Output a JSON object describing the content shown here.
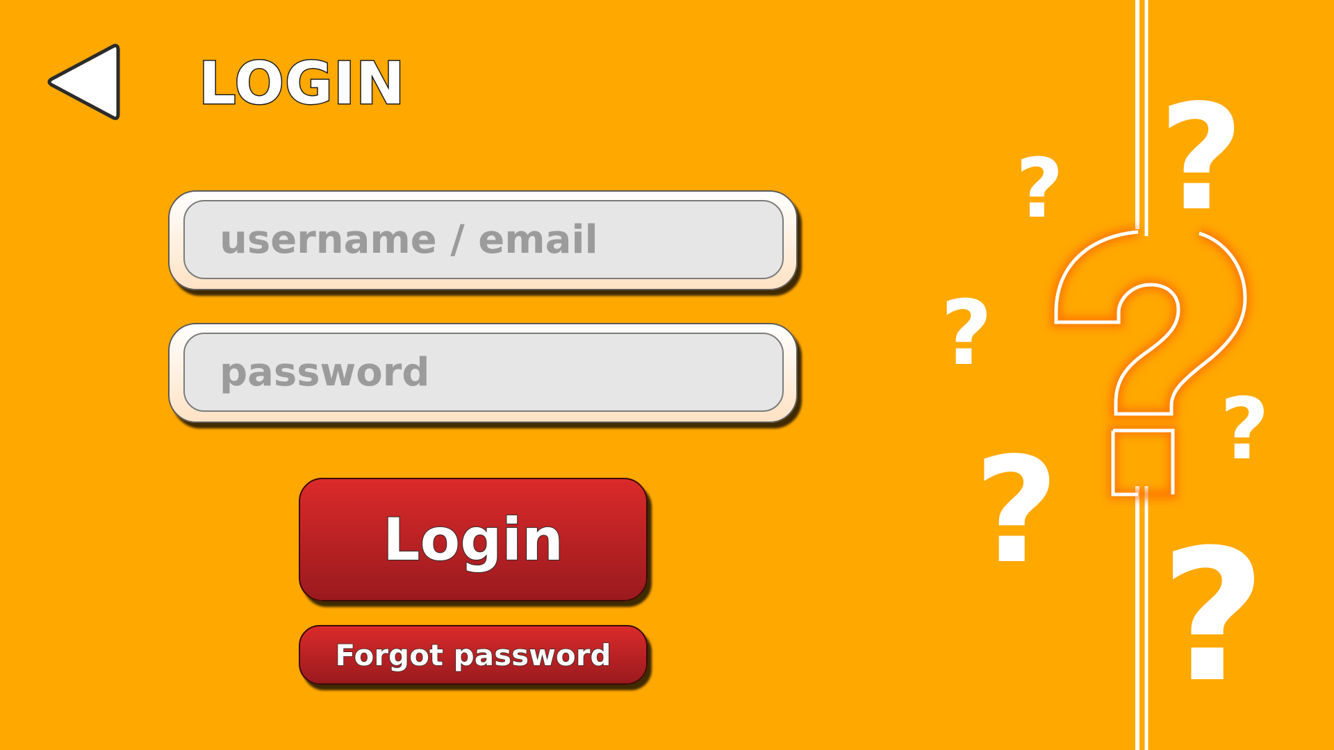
{
  "header": {
    "title": "LOGIN",
    "back_icon": "back-arrow-icon"
  },
  "form": {
    "username": {
      "value": "",
      "placeholder": "username / email"
    },
    "password": {
      "value": "",
      "placeholder": "password"
    }
  },
  "buttons": {
    "login_label": "Login",
    "forgot_label": "Forgot password"
  },
  "decoration": {
    "icon": "question-mark-icon"
  },
  "colors": {
    "background": "#ffa800",
    "button_red": "#c82222",
    "field_fill": "#e6e6e6",
    "field_text": "#9b9b9b"
  }
}
